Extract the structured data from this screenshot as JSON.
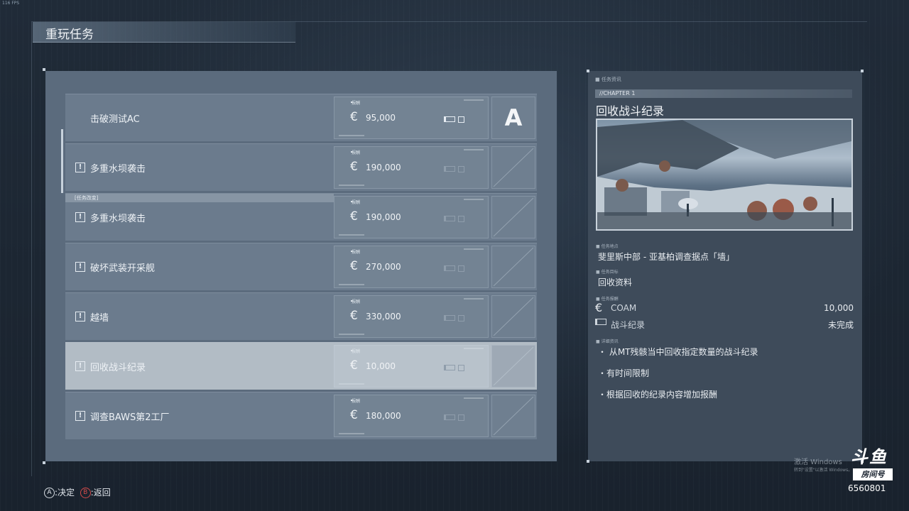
{
  "fps_label": "116 FPS",
  "screen_title": "重玩任务",
  "missions": [
    {
      "name": "击破测试AC",
      "has_alert": false,
      "tag": "",
      "reward_label": "报酬",
      "reward": "95,000",
      "log_complete": true,
      "rank": "A"
    },
    {
      "name": "多重水坝袭击",
      "has_alert": true,
      "tag": "",
      "reward_label": "报酬",
      "reward": "190,000",
      "log_complete": false,
      "rank": ""
    },
    {
      "name": "多重水坝袭击",
      "has_alert": true,
      "tag": "[任务改变]",
      "reward_label": "报酬",
      "reward": "190,000",
      "log_complete": false,
      "rank": ""
    },
    {
      "name": "破坏武装开采舰",
      "has_alert": true,
      "tag": "",
      "reward_label": "报酬",
      "reward": "270,000",
      "log_complete": false,
      "rank": ""
    },
    {
      "name": "越墙",
      "has_alert": true,
      "tag": "",
      "reward_label": "报酬",
      "reward": "330,000",
      "log_complete": false,
      "rank": ""
    },
    {
      "name": "回收战斗纪录",
      "has_alert": true,
      "tag": "",
      "reward_label": "报酬",
      "reward": "10,000",
      "log_complete": false,
      "rank": "",
      "selected": true
    },
    {
      "name": "调查BAWS第2工厂",
      "has_alert": true,
      "tag": "",
      "reward_label": "报酬",
      "reward": "180,000",
      "log_complete": false,
      "rank": ""
    }
  ],
  "detail": {
    "section_header": "任务资讯",
    "chapter": "//CHAPTER 1",
    "title": "回收战斗纪录",
    "location_label": "任务地点",
    "location": "斐里斯中部 - 亚基柏调查据点「墙」",
    "objective_label": "任务目标",
    "objective": "回收资料",
    "reward_label": "任务报酬",
    "reward_currency": "COAM",
    "reward_amount": "10,000",
    "log_label": "战斗纪录",
    "log_status": "未完成",
    "info_label": "详细资讯",
    "details": [
      "・ 从MT残骸当中回收指定数量的战斗纪录",
      "・有时间限制",
      "・根据回收的纪录内容增加报酬"
    ]
  },
  "hints": {
    "a_button": "A",
    "a_label": ":决定",
    "b_button": "B",
    "b_label": ":返回"
  },
  "overlay": {
    "activate_windows": "激活 Windows",
    "activate_windows_sub": "转到\"设置\"以激活 Windows。",
    "logo_top": "斗鱼",
    "logo_bottom": "房间号",
    "room_number": "6560801"
  },
  "colors": {
    "list_bg": "#5b6b7d",
    "row_bg": "#6b7b8d",
    "row_selected_bg": "#b2bcc5",
    "detail_bg": "#3e4b5a",
    "b_button": "#d24a4a"
  }
}
